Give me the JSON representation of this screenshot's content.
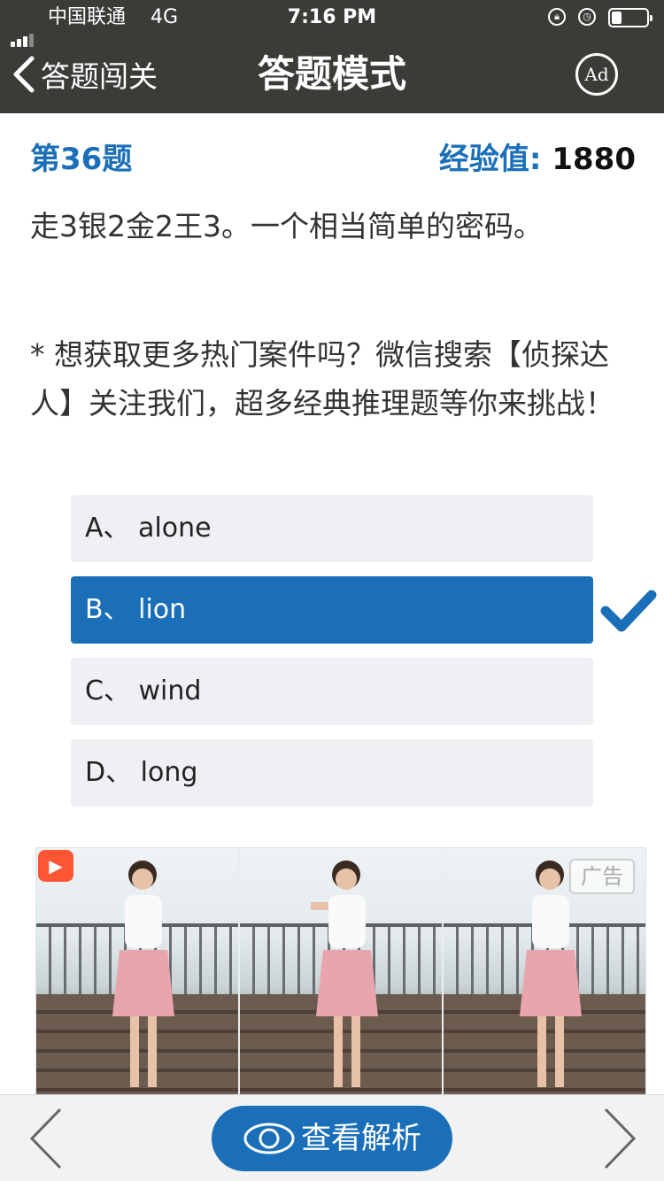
{
  "status_bar": {
    "carrier": "中国联通",
    "network": "4G",
    "time": "7:16 PM",
    "icons": [
      "signal-icon",
      "orientation-lock-icon",
      "alarm-icon",
      "battery-icon"
    ]
  },
  "nav": {
    "back_label": "答题闯关",
    "title": "答题模式",
    "ad_button_label": "Ad"
  },
  "question": {
    "number_label": "第36题",
    "exp_label": "经验值:",
    "exp_value": "1880",
    "text": "走3银2金2王3。一个相当简单的密码。",
    "promo": "* 想获取更多热门案件吗？微信搜索【侦探达人】关注我们，超多经典推理题等你来挑战！"
  },
  "options": [
    {
      "label": "A、 alone",
      "selected": false
    },
    {
      "label": "B、 lion",
      "selected": true
    },
    {
      "label": "C、 wind",
      "selected": false
    },
    {
      "label": "D、 long",
      "selected": false
    }
  ],
  "ad": {
    "tag": "广告",
    "app_badge_icon": "video-app-icon"
  },
  "bottom": {
    "analysis_label": "查看解析",
    "prev_icon": "chevron-left-icon",
    "next_icon": "chevron-right-icon"
  },
  "colors": {
    "accent": "#1a6fb8",
    "topbar": "#3d3b38",
    "option_bg": "#f0f0f4"
  }
}
